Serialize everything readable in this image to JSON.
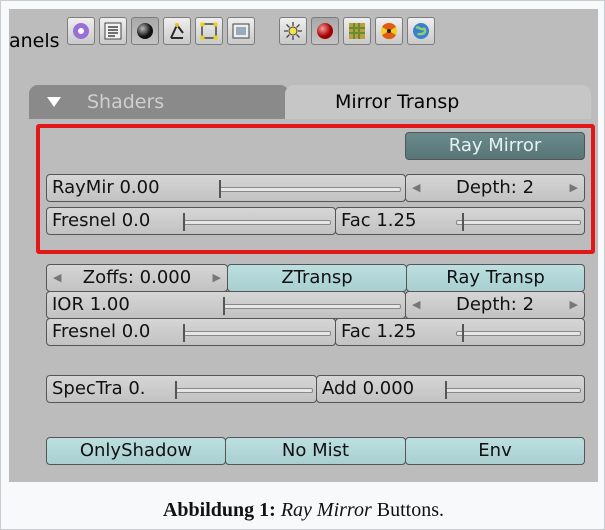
{
  "header": {
    "label": "anels",
    "icons": [
      {
        "name": "logic-icon"
      },
      {
        "name": "script-icon"
      },
      {
        "name": "shading-icon"
      },
      {
        "name": "object-icon"
      },
      {
        "name": "editing-icon"
      },
      {
        "name": "scene-icon"
      },
      {
        "name": "lamp-icon"
      },
      {
        "name": "material-icon"
      },
      {
        "name": "texture-icon"
      },
      {
        "name": "radiosity-icon"
      },
      {
        "name": "world-icon"
      }
    ]
  },
  "tabs": {
    "shaders": "Shaders",
    "mirror_transp": "Mirror Transp"
  },
  "ray_mirror": {
    "toggle": "Ray Mirror",
    "raymir": "RayMir 0.00",
    "raymir_value": 0.0,
    "depth": "Depth: 2",
    "fresnel": "Fresnel 0.0",
    "fac": "Fac 1.25"
  },
  "transparency": {
    "zoffs": "Zoffs: 0.000",
    "ztransp": "ZTransp",
    "ray_transp": "Ray Transp",
    "ior": "IOR 1.00",
    "depth": "Depth: 2",
    "fresnel": "Fresnel 0.0",
    "fac": "Fac 1.25"
  },
  "spec": {
    "spectra": "SpecTra 0.",
    "add": "Add 0.000"
  },
  "bottom": {
    "onlyshadow": "OnlyShadow",
    "no_mist": "No Mist",
    "env": "Env"
  },
  "caption": {
    "prefix": "Abbildung 1:",
    "italic": "Ray Mirror",
    "suffix": "Buttons."
  },
  "colors": {
    "highlight": "#e01818",
    "toggle_on": "#6a8a8c",
    "toggle_off": "#bddfe0"
  }
}
